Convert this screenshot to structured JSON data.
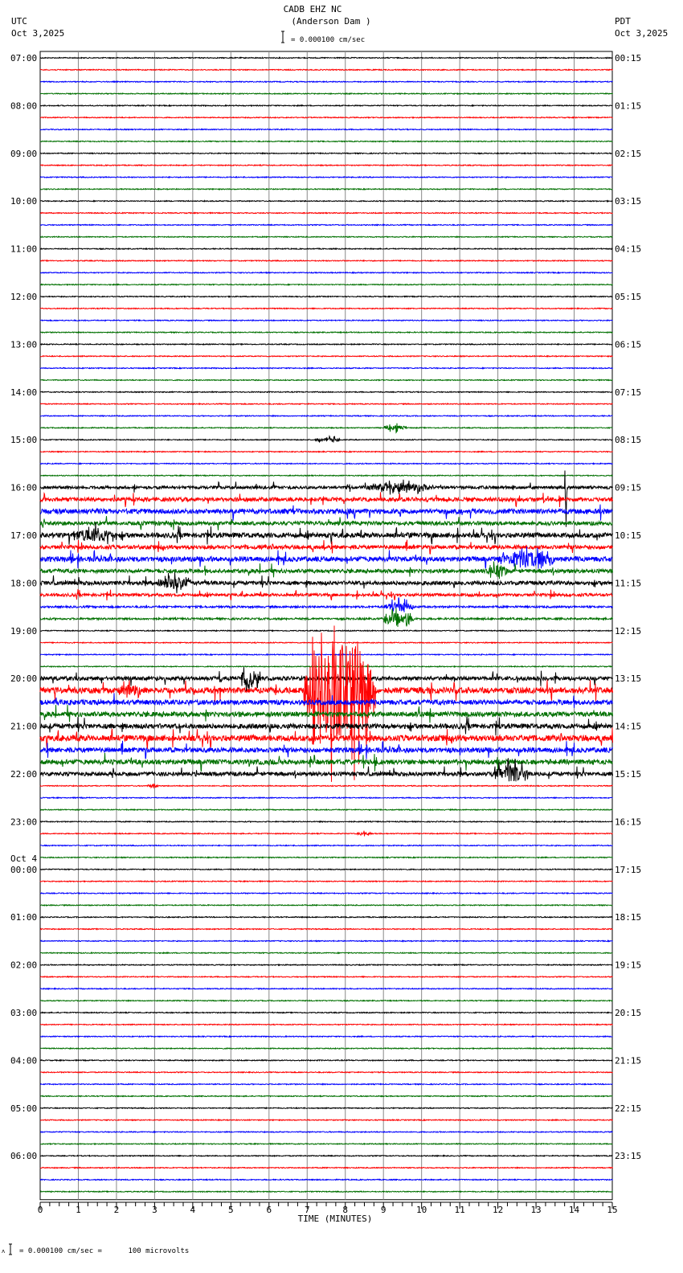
{
  "header": {
    "station": "CADB EHZ NC",
    "location": "(Anderson Dam )",
    "left_tz": "UTC",
    "left_date": "Oct 3,2025",
    "right_tz": "PDT",
    "right_date": "Oct 3,2025",
    "scale_text": "= 0.000100 cm/sec"
  },
  "footer": {
    "scale_text": "= 0.000100 cm/sec =      100 microvolts"
  },
  "chart_data": {
    "type": "line",
    "title": "CADB EHZ NC (Anderson Dam )",
    "xlabel": "TIME (MINUTES)",
    "xlim": [
      0,
      15
    ],
    "x_ticks": [
      "0",
      "1",
      "2",
      "3",
      "4",
      "5",
      "6",
      "7",
      "8",
      "9",
      "10",
      "11",
      "12",
      "13",
      "14",
      "15"
    ],
    "traces_per_hour": 4,
    "trace_count": 96,
    "trace_colors": [
      "#000000",
      "#ff0000",
      "#0000ff",
      "#007000"
    ],
    "left_labels": [
      "07:00",
      "08:00",
      "09:00",
      "10:00",
      "11:00",
      "12:00",
      "13:00",
      "14:00",
      "15:00",
      "16:00",
      "17:00",
      "18:00",
      "19:00",
      "20:00",
      "21:00",
      "22:00",
      "23:00",
      "00:00",
      "01:00",
      "02:00",
      "03:00",
      "04:00",
      "05:00",
      "06:00"
    ],
    "date_change_label": "Oct 4",
    "right_labels": [
      "00:15",
      "01:15",
      "02:15",
      "03:15",
      "04:15",
      "05:15",
      "06:15",
      "07:15",
      "08:15",
      "09:15",
      "10:15",
      "11:15",
      "12:15",
      "13:15",
      "14:15",
      "15:15",
      "16:15",
      "17:15",
      "18:15",
      "19:15",
      "20:15",
      "21:15",
      "22:15",
      "23:15"
    ],
    "noise_level_by_trace": [
      1,
      1,
      1,
      1,
      1,
      1,
      1,
      1,
      1,
      1,
      1,
      1,
      1,
      1,
      1,
      1,
      1,
      1,
      1,
      1,
      1,
      1,
      1,
      1,
      1,
      1,
      1,
      1,
      1,
      1,
      1,
      1,
      1,
      1,
      1,
      1,
      3,
      4,
      5,
      4,
      5,
      4,
      5,
      4,
      4,
      3,
      2,
      2,
      1,
      1,
      1,
      1,
      4,
      6,
      5,
      5,
      5,
      6,
      5,
      5,
      4,
      1,
      1,
      1,
      1,
      1,
      1,
      1,
      1,
      1,
      1,
      1,
      1,
      1,
      1,
      1,
      1,
      1,
      1,
      1,
      1,
      1,
      1,
      1,
      1,
      1,
      1,
      1,
      1,
      1,
      1,
      1,
      1,
      1,
      1,
      1
    ],
    "events": [
      {
        "trace": 31,
        "start_min": 9.0,
        "end_min": 9.6,
        "amplitude": 6
      },
      {
        "trace": 32,
        "start_min": 7.2,
        "end_min": 7.9,
        "amplitude": 5
      },
      {
        "trace": 36,
        "start_min": 8.4,
        "end_min": 10.4,
        "amplitude": 10
      },
      {
        "trace": 36,
        "start_min": 13.75,
        "end_min": 13.8,
        "amplitude": 100
      },
      {
        "trace": 40,
        "start_min": 0.9,
        "end_min": 2.0,
        "amplitude": 18
      },
      {
        "trace": 42,
        "start_min": 12.0,
        "end_min": 13.5,
        "amplitude": 18
      },
      {
        "trace": 43,
        "start_min": 11.7,
        "end_min": 12.3,
        "amplitude": 15
      },
      {
        "trace": 44,
        "start_min": 3.0,
        "end_min": 4.0,
        "amplitude": 14
      },
      {
        "trace": 46,
        "start_min": 9.0,
        "end_min": 9.8,
        "amplitude": 12
      },
      {
        "trace": 47,
        "start_min": 9.0,
        "end_min": 9.8,
        "amplitude": 14
      },
      {
        "trace": 52,
        "start_min": 5.2,
        "end_min": 5.8,
        "amplitude": 20
      },
      {
        "trace": 53,
        "start_min": 6.9,
        "end_min": 8.8,
        "amplitude": 130
      },
      {
        "trace": 53,
        "start_min": 2.0,
        "end_min": 2.7,
        "amplitude": 14
      },
      {
        "trace": 60,
        "start_min": 11.8,
        "end_min": 12.8,
        "amplitude": 22
      },
      {
        "trace": 61,
        "start_min": 2.8,
        "end_min": 3.1,
        "amplitude": 5
      },
      {
        "trace": 65,
        "start_min": 8.3,
        "end_min": 8.7,
        "amplitude": 4
      }
    ]
  }
}
